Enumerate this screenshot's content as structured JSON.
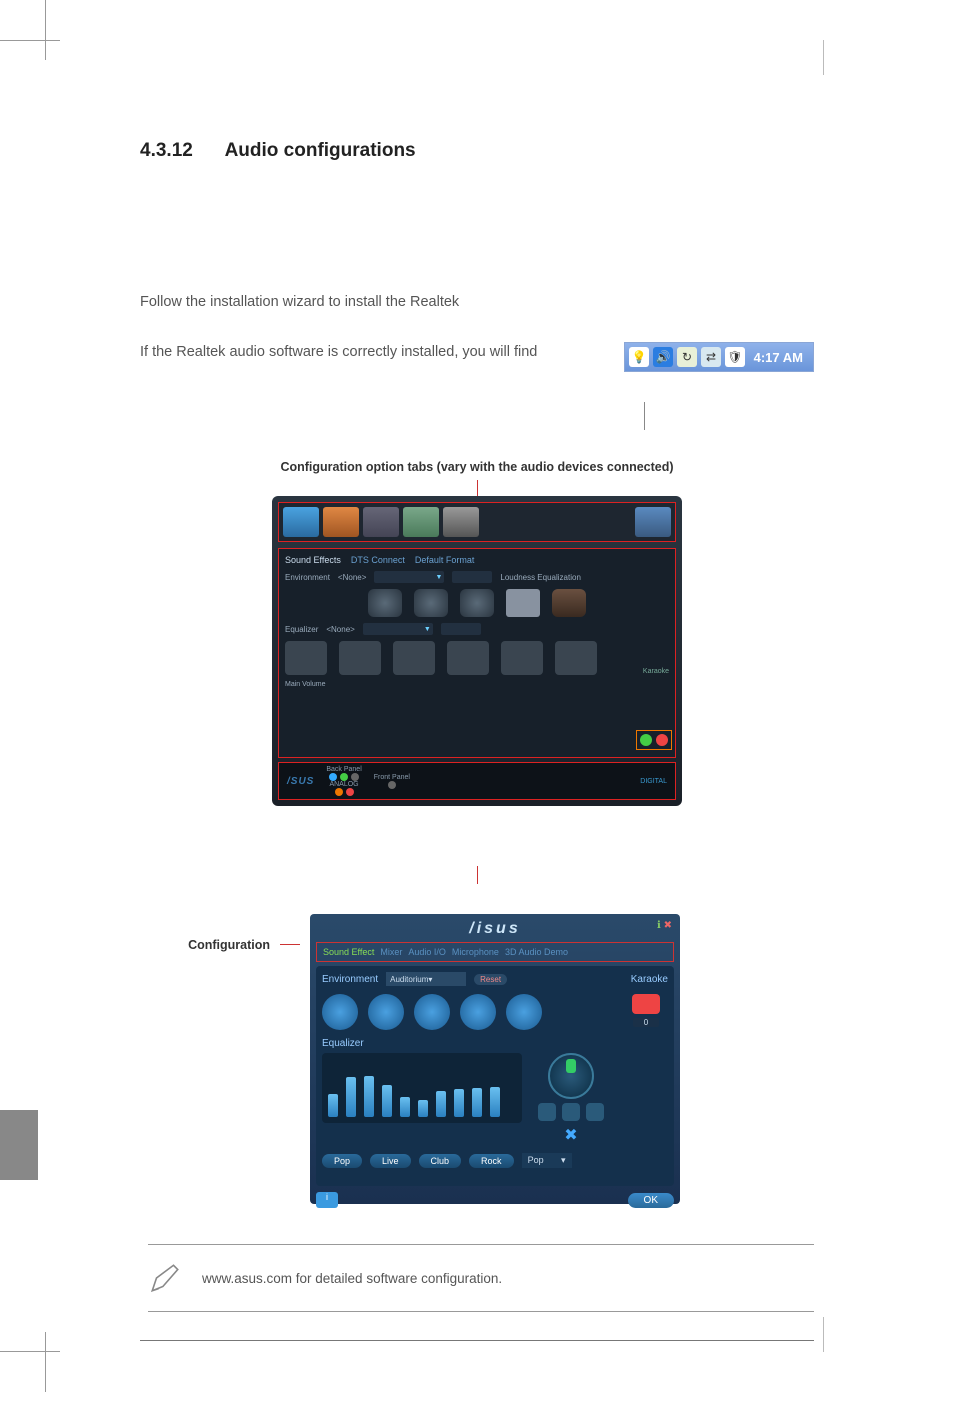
{
  "section": {
    "number": "4.3.12",
    "title": "Audio configurations"
  },
  "para1": "Follow the installation wizard to install the Realtek",
  "para2": "If the Realtek audio software is correctly installed, you will find",
  "tray": {
    "time": "4:17 AM",
    "icons": [
      "tip",
      "speaker",
      "refresh",
      "net",
      "shield"
    ]
  },
  "caption_tabs": "Configuration option tabs (vary with the audio devices connected)",
  "vista_app": {
    "subtabs": [
      "Sound Effects",
      "DTS Connect",
      "Default Format"
    ],
    "env_label": "Environment",
    "env_value": "<None>",
    "loudness": "Loudness Equalization",
    "eq_label": "Equalizer",
    "eq_value": "<None>",
    "karaoke": "Karaoke",
    "main_volume": "Main Volume",
    "back_panel": "Back Panel",
    "front_panel": "Front Panel",
    "analog": "ANALOG",
    "digital": "DIGITAL",
    "logo": "/SUS"
  },
  "xp_label": "Configuration",
  "xp_app": {
    "logo": "/isus",
    "tabs": [
      "Sound Effect",
      "Mixer",
      "Audio I/O",
      "Microphone",
      "3D Audio Demo"
    ],
    "env_label": "Environment",
    "env_value": "Auditorium",
    "reset": "Reset",
    "karaoke": "Karaoke",
    "kara_num": "0",
    "eq_label": "Equalizer",
    "presets": [
      "Pop",
      "Live",
      "Club",
      "Rock"
    ],
    "preset_sel": "Pop",
    "ok": "OK"
  },
  "note": "www.asus.com for detailed software configuration."
}
